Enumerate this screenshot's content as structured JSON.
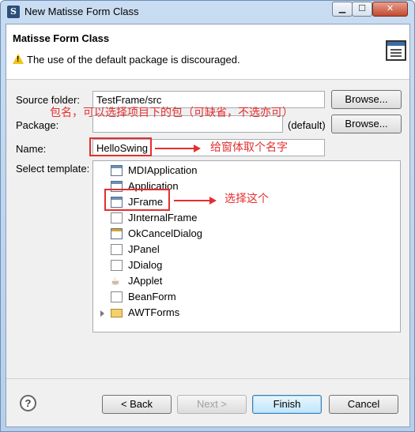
{
  "window": {
    "title": "New Matisse Form Class"
  },
  "header": {
    "title": "Matisse Form Class",
    "message": "The use of the default package is discouraged."
  },
  "form": {
    "source_folder_label": "Source folder:",
    "source_folder_value": "TestFrame/src",
    "package_label": "Package:",
    "package_value": "",
    "package_default": "(default)",
    "name_label": "Name:",
    "name_value": "HelloSwing",
    "template_label": "Select template:",
    "browse_label": "Browse..."
  },
  "templates": [
    {
      "label": "MDIApplication",
      "icon": "window-icon"
    },
    {
      "label": "Application",
      "icon": "window-icon"
    },
    {
      "label": "JFrame",
      "icon": "window-icon"
    },
    {
      "label": "JInternalFrame",
      "icon": "document-icon"
    },
    {
      "label": "OkCancelDialog",
      "icon": "dialog-icon"
    },
    {
      "label": "JPanel",
      "icon": "document-icon"
    },
    {
      "label": "JDialog",
      "icon": "document-icon"
    },
    {
      "label": "JApplet",
      "icon": "applet-icon"
    },
    {
      "label": "BeanForm",
      "icon": "document-icon"
    },
    {
      "label": "AWTForms",
      "icon": "folder-icon"
    }
  ],
  "annotations": {
    "package_note": "包名，可以选择项目下的包（可缺省，不选亦可）",
    "name_note": "给窗体取个名字",
    "template_note": "选择这个"
  },
  "buttons": {
    "back": "< Back",
    "next": "Next >",
    "finish": "Finish",
    "cancel": "Cancel"
  },
  "colors": {
    "annotation": "#e52e2e",
    "primary_button": "#3c7fb1"
  }
}
